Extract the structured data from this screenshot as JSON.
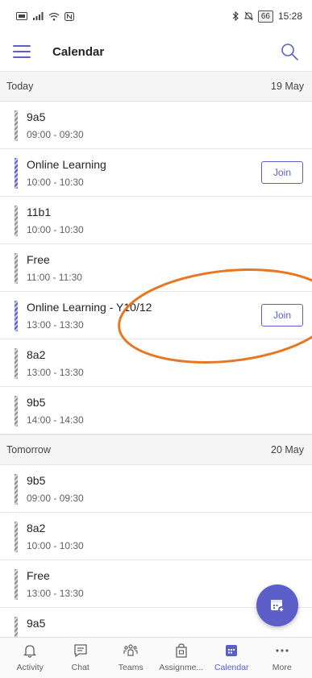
{
  "status_bar": {
    "battery": "66",
    "time": "15:28"
  },
  "header": {
    "title": "Calendar"
  },
  "sections": [
    {
      "label": "Today",
      "date": "19 May",
      "events": [
        {
          "title": "9a5",
          "time": "09:00 - 09:30",
          "join": ""
        },
        {
          "title": "Online Learning",
          "time": "10:00 - 10:30",
          "join": "Join"
        },
        {
          "title": "11b1",
          "time": "10:00 - 10:30",
          "join": ""
        },
        {
          "title": "Free",
          "time": "11:00 - 11:30",
          "join": ""
        },
        {
          "title": "Online Learning - Y10/12",
          "time": "13:00 - 13:30",
          "join": "Join"
        },
        {
          "title": "8a2",
          "time": "13:00 - 13:30",
          "join": ""
        },
        {
          "title": "9b5",
          "time": "14:00 - 14:30",
          "join": ""
        }
      ]
    },
    {
      "label": "Tomorrow",
      "date": "20 May",
      "events": [
        {
          "title": "9b5",
          "time": "09:00 - 09:30",
          "join": ""
        },
        {
          "title": "8a2",
          "time": "10:00 - 10:30",
          "join": ""
        },
        {
          "title": "Free",
          "time": "13:00 - 13:30",
          "join": ""
        },
        {
          "title": "9a5",
          "time": "",
          "join": ""
        }
      ]
    }
  ],
  "fab": {
    "icon": "calendar-add-icon"
  },
  "bottom_nav": [
    {
      "label": "Activity",
      "icon": "bell-icon"
    },
    {
      "label": "Chat",
      "icon": "chat-icon"
    },
    {
      "label": "Teams",
      "icon": "teams-icon"
    },
    {
      "label": "Assignme...",
      "icon": "assignments-icon"
    },
    {
      "label": "Calendar",
      "icon": "calendar-icon"
    },
    {
      "label": "More",
      "icon": "more-icon"
    }
  ],
  "colors": {
    "accent": "#5b5fc7",
    "annotation": "#e87722"
  }
}
